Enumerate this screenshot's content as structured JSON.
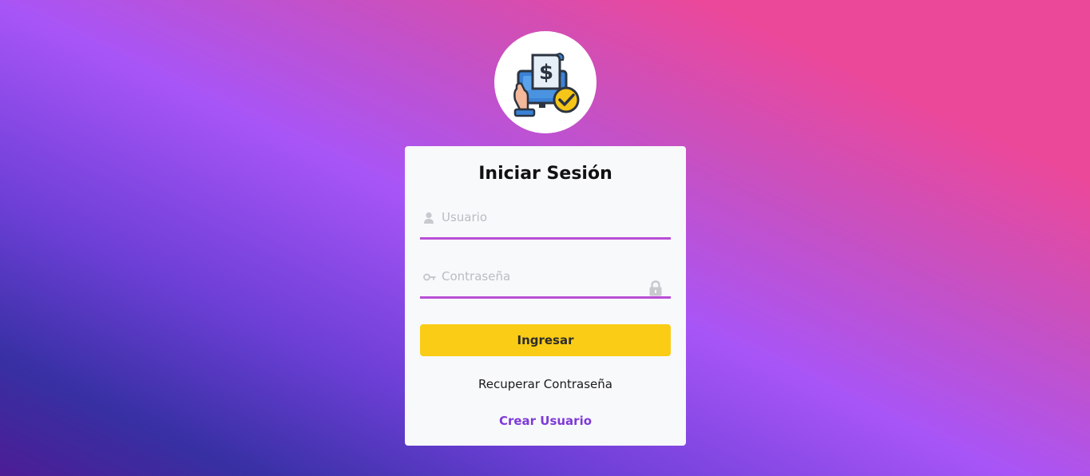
{
  "logo": {
    "icon": "payment-receipt-check-icon"
  },
  "login": {
    "title": "Iniciar Sesión",
    "username": {
      "placeholder": "Usuario",
      "value": "",
      "icon": "user-icon"
    },
    "password": {
      "placeholder": "Contraseña",
      "value": "",
      "icon": "key-icon",
      "trailing_icon": "lock-icon"
    },
    "submit_label": "Ingresar",
    "recover_label": "Recuperar Contraseña",
    "create_label": "Crear Usuario"
  },
  "colors": {
    "accent_underline": "#b84fd6",
    "button": "#facc15",
    "link": "#7e3bd6",
    "card": "#f8f9fb"
  }
}
